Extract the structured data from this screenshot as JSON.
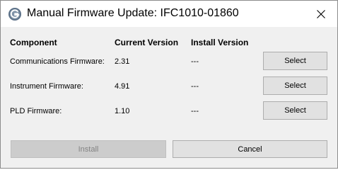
{
  "window": {
    "title": "Manual Firmware Update: IFC1010-01860",
    "app_icon": "g-logo-icon",
    "close_icon": "close-icon"
  },
  "table": {
    "headers": {
      "component": "Component",
      "current_version": "Current Version",
      "install_version": "Install Version"
    },
    "rows": [
      {
        "component": "Communications Firmware:",
        "current_version": "2.31",
        "install_version": "---",
        "action_label": "Select"
      },
      {
        "component": "Instrument Firmware:",
        "current_version": "4.91",
        "install_version": "---",
        "action_label": "Select"
      },
      {
        "component": "PLD Firmware:",
        "current_version": "1.10",
        "install_version": "---",
        "action_label": "Select"
      }
    ]
  },
  "footer": {
    "install_label": "Install",
    "install_enabled": false,
    "cancel_label": "Cancel"
  }
}
